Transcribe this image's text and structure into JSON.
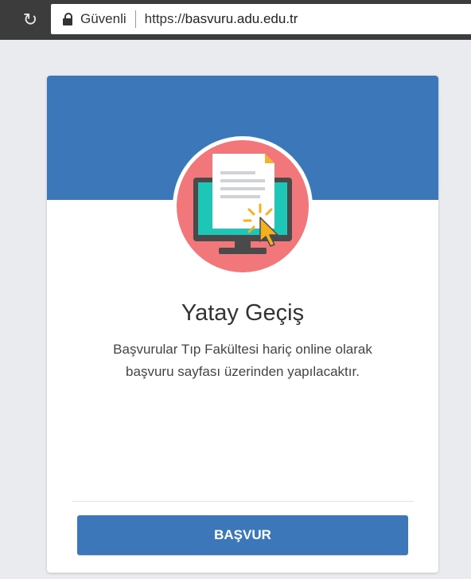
{
  "browser": {
    "security_label": "Güvenli",
    "url_scheme": "https://",
    "url_host": "basvuru.adu.edu.tr"
  },
  "card": {
    "title": "Yatay Geçiş",
    "description_line1": "Başvurular Tıp Fakültesi hariç online olarak",
    "description_line2": "başvuru sayfası üzerinden yapılacaktır.",
    "button_label": "BAŞVUR",
    "accent_color": "#3c78b9",
    "hero_circle_color": "#f2777a"
  }
}
